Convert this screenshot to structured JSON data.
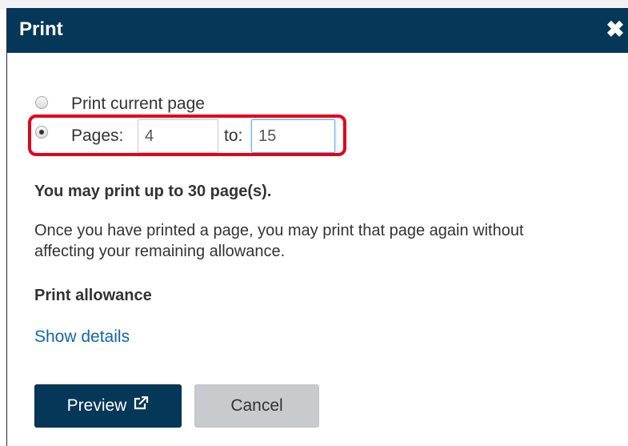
{
  "dialog": {
    "title": "Print",
    "close_glyph": "✖"
  },
  "options": {
    "current_page_label": "Print current page",
    "pages_label": "Pages:",
    "to_label": "to:",
    "from_value": "4",
    "to_value": "15",
    "selected": "pages"
  },
  "info": {
    "limit_text": "You may print up to 30 page(s).",
    "reprint_note": "Once you have printed a page, you may print that page again without affecting your remaining allowance.",
    "allowance_heading": "Print allowance",
    "show_details_link": "Show details"
  },
  "buttons": {
    "preview_label": "Preview",
    "preview_icon": "external-link-icon",
    "cancel_label": "Cancel"
  },
  "colors": {
    "header_bg": "#053758",
    "link": "#1466a6",
    "highlight": "#e0001b",
    "cancel_bg": "#c7cbce"
  }
}
